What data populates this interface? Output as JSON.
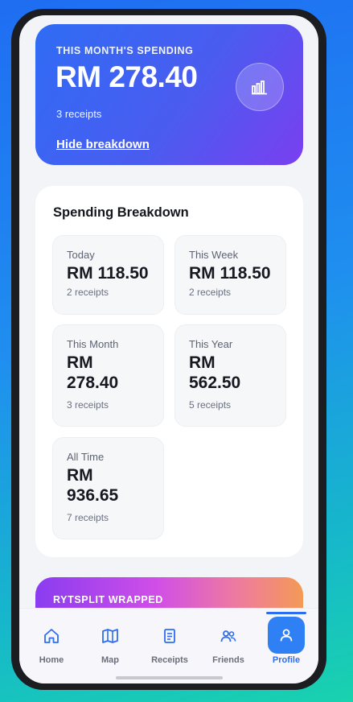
{
  "hero": {
    "label": "THIS MONTH'S SPENDING",
    "amount": "RM 278.40",
    "receipts": "3 receipts",
    "toggle": "Hide breakdown",
    "icon": "bar-chart-icon"
  },
  "breakdown": {
    "title": "Spending Breakdown",
    "tiles": [
      {
        "period": "Today",
        "amount": "RM 118.50",
        "receipts": "2 receipts"
      },
      {
        "period": "This Week",
        "amount": "RM 118.50",
        "receipts": "2 receipts"
      },
      {
        "period": "This Month",
        "amount_line1": "RM",
        "amount_line2": "278.40",
        "receipts": "3 receipts"
      },
      {
        "period": "This Year",
        "amount_line1": "RM",
        "amount_line2": "562.50",
        "receipts": "5 receipts"
      },
      {
        "period": "All Time",
        "amount_line1": "RM",
        "amount_line2": "936.65",
        "receipts": "7 receipts"
      }
    ]
  },
  "wrapped": {
    "label": "RYTSPLIT WRAPPED"
  },
  "nav": {
    "items": [
      {
        "label": "Home",
        "icon": "home-icon"
      },
      {
        "label": "Map",
        "icon": "map-icon"
      },
      {
        "label": "Receipts",
        "icon": "receipt-icon"
      },
      {
        "label": "Friends",
        "icon": "friends-icon"
      },
      {
        "label": "Profile",
        "icon": "profile-icon"
      }
    ],
    "active": "Profile"
  },
  "colors": {
    "accent": "#2d6df2",
    "hero_start": "#2f6cf5",
    "hero_end": "#7a3ff0"
  }
}
